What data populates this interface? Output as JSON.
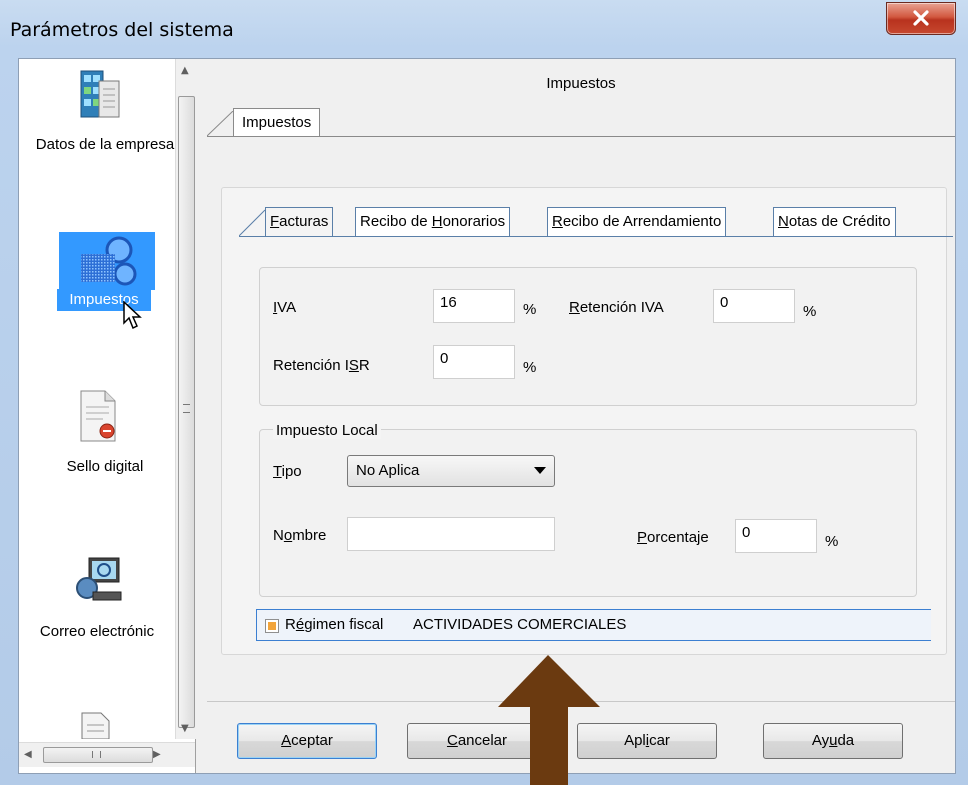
{
  "window": {
    "title": "Parámetros del sistema"
  },
  "sidebar": {
    "items": [
      {
        "label": "Datos de la empresa",
        "icon": "building-icon"
      },
      {
        "label": "Impuestos",
        "icon": "tax-gears-icon",
        "selected": true
      },
      {
        "label": "Sello digital",
        "icon": "certificate-icon"
      },
      {
        "label": "Correo electrónic",
        "icon": "email-globe-icon"
      },
      {
        "label": "",
        "icon": "document-icon"
      }
    ]
  },
  "panel": {
    "title": "Impuestos",
    "outer_tab": "Impuestos",
    "inner_tabs": [
      {
        "pre": "",
        "key": "F",
        "post": "acturas",
        "active": true
      },
      {
        "pre": "Recibo de ",
        "key": "H",
        "post": "onorarios",
        "active": false
      },
      {
        "pre": "",
        "key": "R",
        "post": "ecibo de Arrendamiento",
        "active": false
      },
      {
        "pre": "",
        "key": "N",
        "post": "otas de Crédito",
        "active": false
      }
    ],
    "iva": {
      "key": "I",
      "rest": "VA",
      "value": "16",
      "unit": "%"
    },
    "retencion_iva": {
      "key": "R",
      "rest": "etención IVA",
      "value": "0",
      "unit": "%"
    },
    "retencion_isr": {
      "pre": "Retención I",
      "key": "S",
      "post": "R",
      "value": "0",
      "unit": "%"
    },
    "impuesto_local": {
      "title": "Impuesto Local",
      "tipo": {
        "key": "T",
        "rest": "ipo",
        "value": "No Aplica"
      },
      "nombre": {
        "pre": "N",
        "key": "o",
        "post": "mbre",
        "value": ""
      },
      "porcentaje": {
        "key": "P",
        "rest": "orcentaje",
        "value": "0",
        "unit": "%"
      }
    },
    "regimen": {
      "pre": "R",
      "key": "é",
      "post": "gimen fiscal",
      "value": "ACTIVIDADES COMERCIALES",
      "checked": true
    }
  },
  "buttons": {
    "aceptar": {
      "key": "A",
      "rest": "ceptar"
    },
    "cancelar": {
      "key": "C",
      "rest": "ancelar"
    },
    "aplicar": {
      "pre": "Apl",
      "key": "i",
      "post": "car"
    },
    "ayuda": {
      "pre": "Ay",
      "key": "u",
      "post": "da"
    }
  },
  "colors": {
    "selection": "#3399ff",
    "annotation_arrow": "#6b3a10",
    "focus_border": "#3c7fd1"
  }
}
